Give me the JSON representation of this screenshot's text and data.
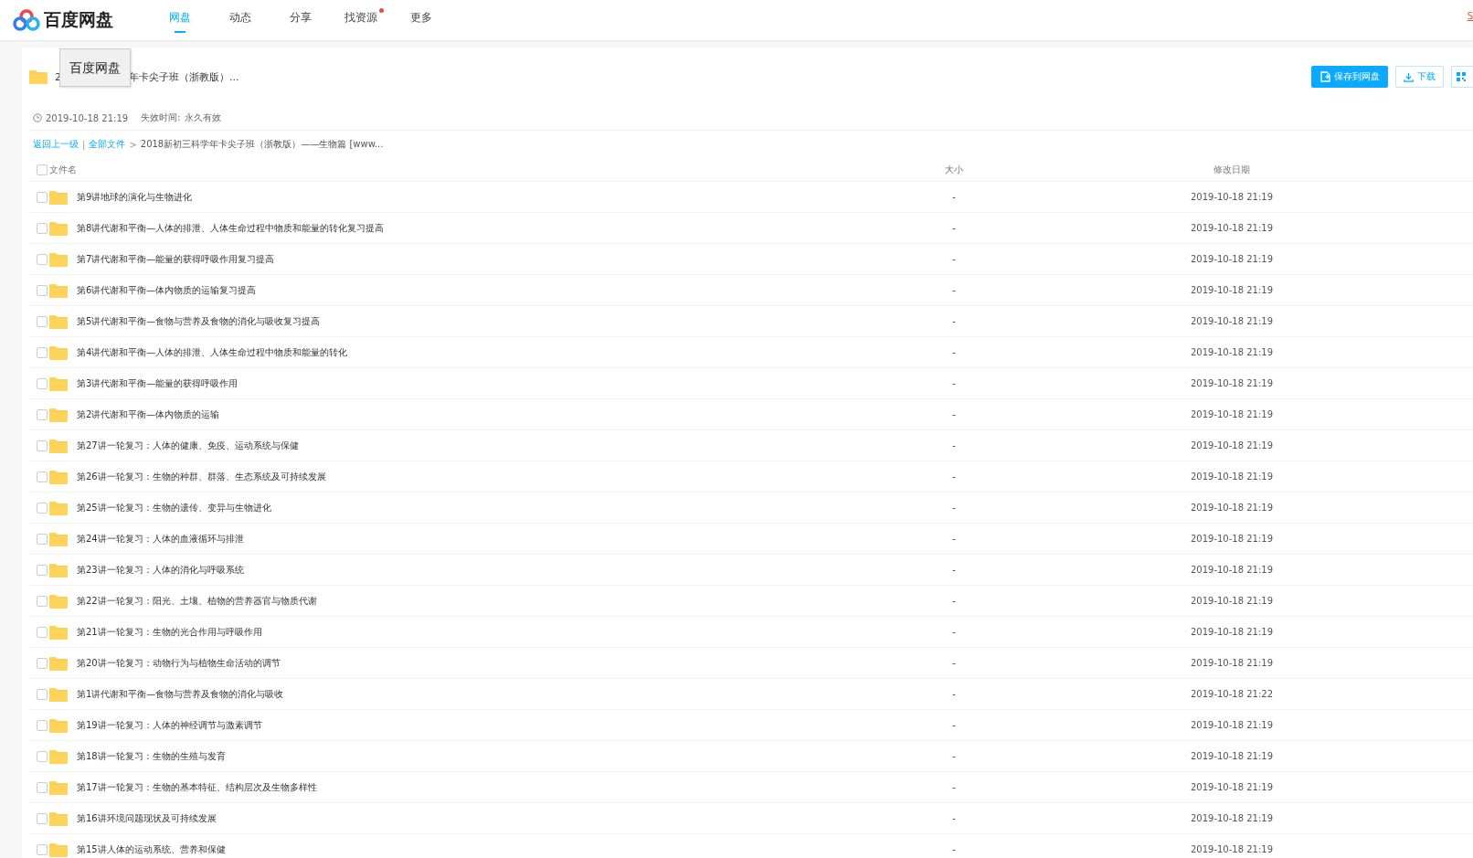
{
  "header": {
    "logo_text": "百度网盘",
    "tabs": [
      {
        "label": "网盘",
        "selected": true,
        "dot": false
      },
      {
        "label": "动态",
        "selected": false,
        "dot": false
      },
      {
        "label": "分享",
        "selected": false,
        "dot": false
      },
      {
        "label": "找资源",
        "selected": false,
        "dot": true
      },
      {
        "label": "更多",
        "selected": false,
        "dot": false
      }
    ],
    "corner_link": "S"
  },
  "share": {
    "title_start": "2",
    "tooltip": "百度网盘",
    "title_end": "年卡尖子班（浙教版）...",
    "created": "2019-10-18 21:19",
    "expiry_label": "失效时间:",
    "expiry_value": "永久有效",
    "buttons": [
      {
        "kind": "primary",
        "label": "保存到网盘"
      },
      {
        "kind": "outline",
        "label": "下载"
      },
      {
        "kind": "icon"
      }
    ]
  },
  "breadcrumb": {
    "back": "返回上一级",
    "divider": "|",
    "root": "全部文件",
    "arrow": ">",
    "current": "2018新初三科学年卡尖子班（浙教版）——生物篇 [www..."
  },
  "table": {
    "select_all_checked": false,
    "columns": [
      "文件名",
      "大小",
      "修改日期"
    ],
    "rows": [
      {
        "name": "第9讲地球的演化与生物进化",
        "size": "-",
        "date": "2019-10-18 21:19",
        "checked": false
      },
      {
        "name": "第8讲代谢和平衡—人体的排泄、人体生命过程中物质和能量的转化复习提高",
        "size": "-",
        "date": "2019-10-18 21:19",
        "checked": false
      },
      {
        "name": "第7讲代谢和平衡—能量的获得呼吸作用复习提高",
        "size": "-",
        "date": "2019-10-18 21:19",
        "checked": false
      },
      {
        "name": "第6讲代谢和平衡—体内物质的运输复习提高",
        "size": "-",
        "date": "2019-10-18 21:19",
        "checked": false
      },
      {
        "name": "第5讲代谢和平衡—食物与营养及食物的消化与吸收复习提高",
        "size": "-",
        "date": "2019-10-18 21:19",
        "checked": false
      },
      {
        "name": "第4讲代谢和平衡—人体的排泄、人体生命过程中物质和能量的转化",
        "size": "-",
        "date": "2019-10-18 21:19",
        "checked": false
      },
      {
        "name": "第3讲代谢和平衡—能量的获得呼吸作用",
        "size": "-",
        "date": "2019-10-18 21:19",
        "checked": false
      },
      {
        "name": "第2讲代谢和平衡—体内物质的运输",
        "size": "-",
        "date": "2019-10-18 21:19",
        "checked": false
      },
      {
        "name": "第27讲一轮复习：人体的健康、免疫、运动系统与保健",
        "size": "-",
        "date": "2019-10-18 21:19",
        "checked": false
      },
      {
        "name": "第26讲一轮复习：生物的种群、群落、生态系统及可持续发展",
        "size": "-",
        "date": "2019-10-18 21:19",
        "checked": false
      },
      {
        "name": "第25讲一轮复习：生物的遗传、变异与生物进化",
        "size": "-",
        "date": "2019-10-18 21:19",
        "checked": false
      },
      {
        "name": "第24讲一轮复习：人体的血液循环与排泄",
        "size": "-",
        "date": "2019-10-18 21:19",
        "checked": false
      },
      {
        "name": "第23讲一轮复习：人体的消化与呼吸系统",
        "size": "-",
        "date": "2019-10-18 21:19",
        "checked": false
      },
      {
        "name": "第22讲一轮复习：阳光、土壤、植物的营养器官与物质代谢",
        "size": "-",
        "date": "2019-10-18 21:19",
        "checked": false
      },
      {
        "name": "第21讲一轮复习：生物的光合作用与呼吸作用",
        "size": "-",
        "date": "2019-10-18 21:19",
        "checked": false
      },
      {
        "name": "第20讲一轮复习：动物行为与植物生命活动的调节",
        "size": "-",
        "date": "2019-10-18 21:19",
        "checked": false
      },
      {
        "name": "第1讲代谢和平衡—食物与营养及食物的消化与吸收",
        "size": "-",
        "date": "2019-10-18 21:22",
        "checked": false
      },
      {
        "name": "第19讲一轮复习：人体的神经调节与激素调节",
        "size": "-",
        "date": "2019-10-18 21:19",
        "checked": false
      },
      {
        "name": "第18讲一轮复习：生物的生殖与发育",
        "size": "-",
        "date": "2019-10-18 21:19",
        "checked": false
      },
      {
        "name": "第17讲一轮复习：生物的基本特征、结构层次及生物多样性",
        "size": "-",
        "date": "2019-10-18 21:19",
        "checked": false
      },
      {
        "name": "第16讲环境问题现状及可持续发展",
        "size": "-",
        "date": "2019-10-18 21:19",
        "checked": false
      },
      {
        "name": "第15讲人体的运动系统、营养和保健",
        "size": "-",
        "date": "2019-10-18 21:19",
        "checked": false
      }
    ]
  }
}
